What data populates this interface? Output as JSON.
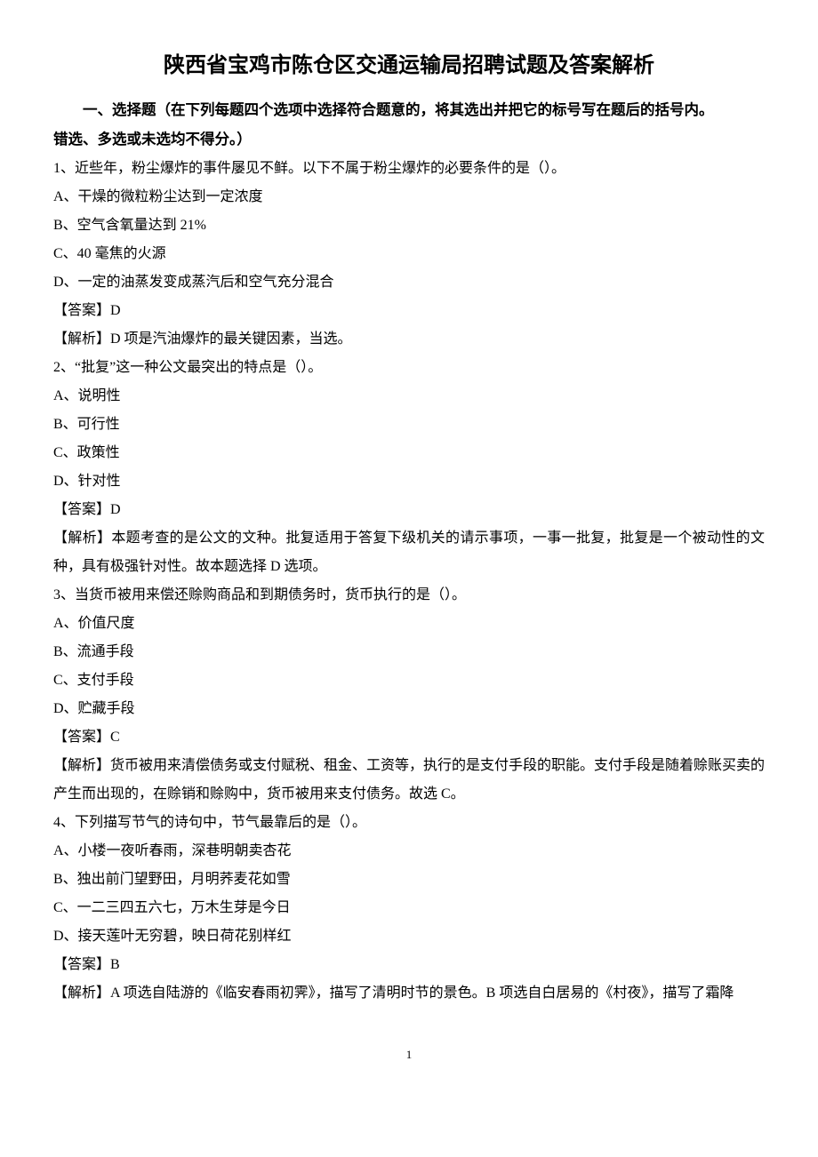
{
  "title": "陕西省宝鸡市陈仓区交通运输局招聘试题及答案解析",
  "section": {
    "header_line1": "一、选择题（在下列每题四个选项中选择符合题意的，将其选出并把它的标号写在题后的括号内。",
    "header_line2": "错选、多选或未选均不得分。）"
  },
  "questions": [
    {
      "stem": "1、近些年，粉尘爆炸的事件屡见不鲜。以下不属于粉尘爆炸的必要条件的是（）。",
      "options": [
        "A、干燥的微粒粉尘达到一定浓度",
        "B、空气含氧量达到 21%",
        "C、40 毫焦的火源",
        "D、一定的油蒸发变成蒸汽后和空气充分混合"
      ],
      "answer": "【答案】D",
      "explain": "【解析】D 项是汽油爆炸的最关键因素，当选。"
    },
    {
      "stem": "2、“批复”这一种公文最突出的特点是（）。",
      "options": [
        "A、说明性",
        "B、可行性",
        "C、政策性",
        "D、针对性"
      ],
      "answer": "【答案】D",
      "explain": "【解析】本题考查的是公文的文种。批复适用于答复下级机关的请示事项，一事一批复，批复是一个被动性的文种，具有极强针对性。故本题选择 D 选项。"
    },
    {
      "stem": "3、当货币被用来偿还赊购商品和到期债务时，货币执行的是（）。",
      "options": [
        "A、价值尺度",
        "B、流通手段",
        "C、支付手段",
        "D、贮藏手段"
      ],
      "answer": "【答案】C",
      "explain": "【解析】货币被用来清偿债务或支付赋税、租金、工资等，执行的是支付手段的职能。支付手段是随着赊账买卖的产生而出现的，在赊销和赊购中，货币被用来支付债务。故选 C。"
    },
    {
      "stem": "4、下列描写节气的诗句中，节气最靠后的是（）。",
      "options": [
        "A、小楼一夜听春雨，深巷明朝卖杏花",
        "B、独出前门望野田，月明荞麦花如雪",
        "C、一二三四五六七，万木生芽是今日",
        "D、接天莲叶无穷碧，映日荷花别样红"
      ],
      "answer": "【答案】B",
      "explain": "【解析】A 项选自陆游的《临安春雨初霁》，描写了清明时节的景色。B 项选自白居易的《村夜》，描写了霜降"
    }
  ],
  "page_number": "1"
}
